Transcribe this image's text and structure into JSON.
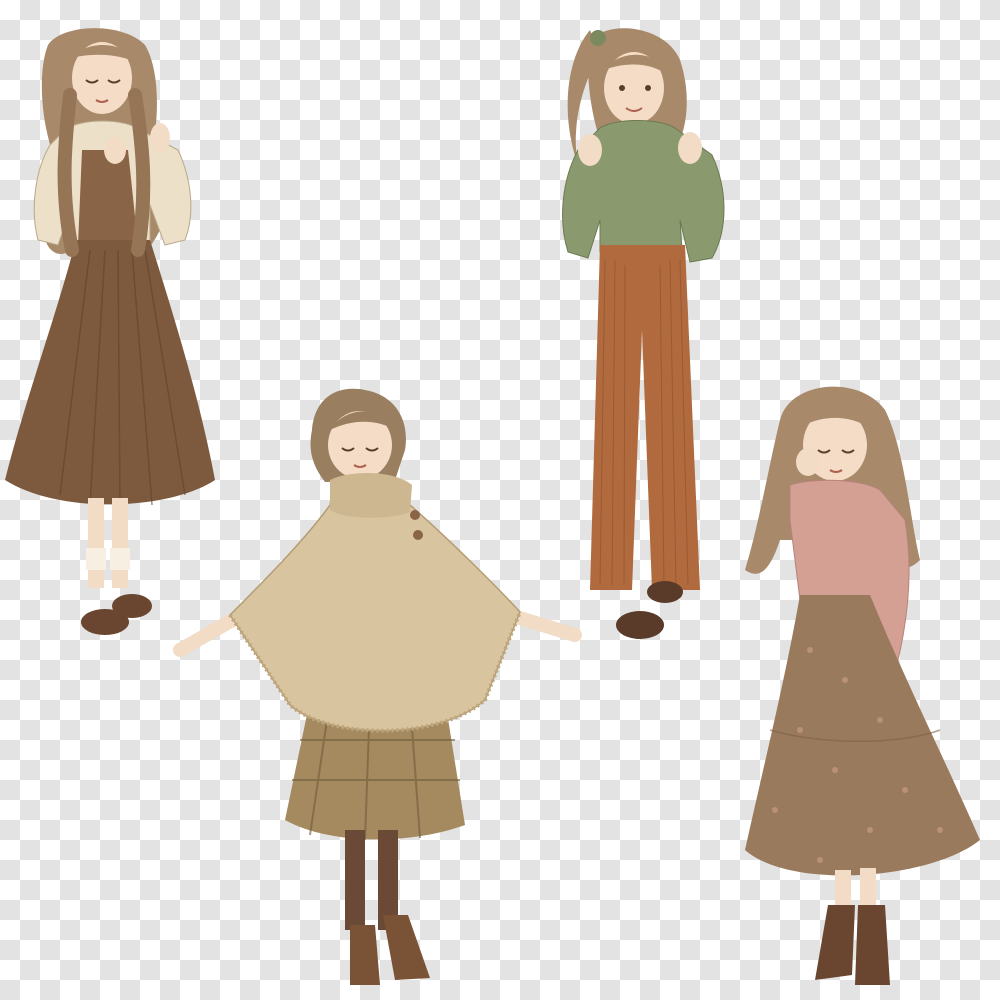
{
  "image": {
    "background": "transparency-checkerboard",
    "checker_colors": [
      "#ffffff",
      "#e3e3e3"
    ]
  },
  "figures": [
    {
      "name": "girl-braids-cream-blouse-brown-skirt",
      "colors": {
        "hair": "#a88a6a",
        "top": "#ece0c8",
        "skirt": "#7d5a3e",
        "shoes": "#6a4630"
      }
    },
    {
      "name": "girl-ponytail-green-sweater-rust-trousers",
      "colors": {
        "hair": "#a88a6a",
        "top": "#8b9a6e",
        "trousers": "#b06a3e",
        "shoes": "#5a3a28"
      }
    },
    {
      "name": "girl-beige-poncho-plaid-skirt",
      "colors": {
        "hair": "#9a7e60",
        "poncho": "#d9c4a0",
        "skirt": "#a58a60",
        "tights": "#6a4a36",
        "boots": "#7a5236"
      }
    },
    {
      "name": "girl-pink-sweater-floral-skirt",
      "colors": {
        "hair": "#a88a6a",
        "top": "#d4a094",
        "skirt": "#9a7a5c",
        "boots": "#6a4630"
      }
    }
  ]
}
